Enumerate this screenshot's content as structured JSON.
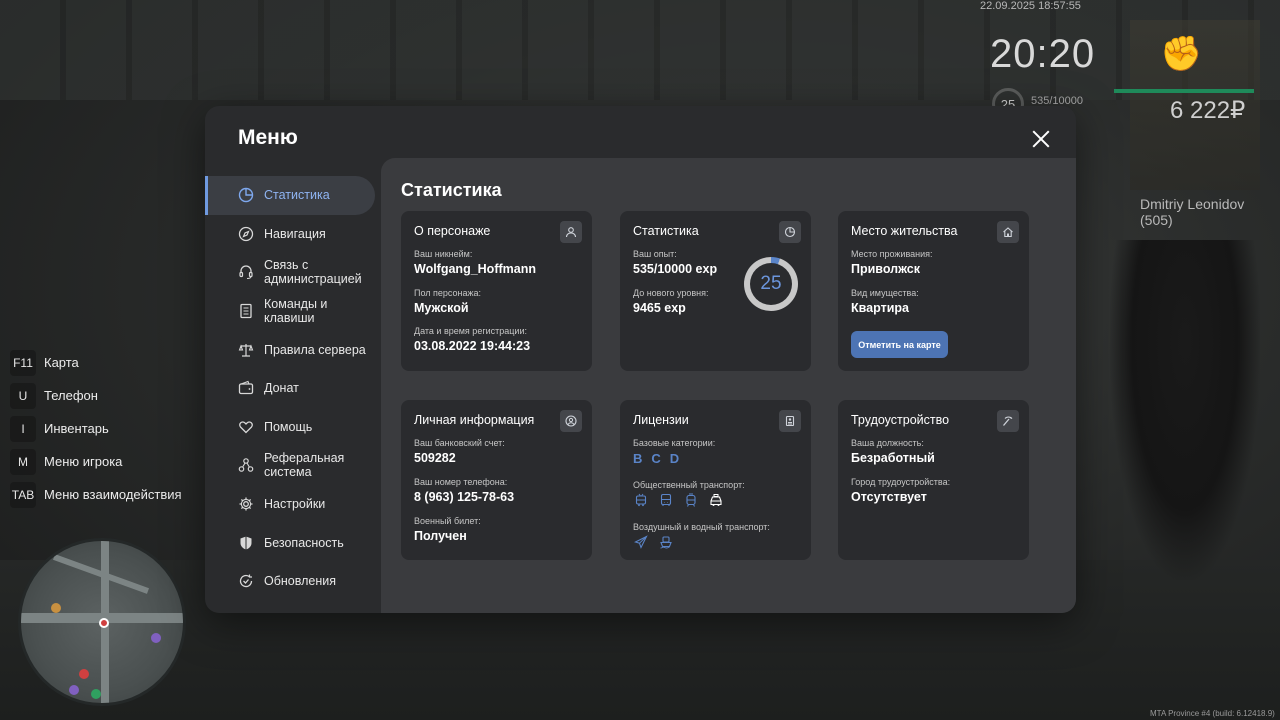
{
  "hud": {
    "datetime": "22.09.2025 18:57:55",
    "clock": "20:20",
    "level": "25",
    "exp": "535/10000",
    "money": "6 222₽",
    "player_tag": "Dmitriy Leonidov (505)"
  },
  "keys": [
    {
      "key": "F11",
      "label": "Карта"
    },
    {
      "key": "U",
      "label": "Телефон"
    },
    {
      "key": "I",
      "label": "Инвентарь"
    },
    {
      "key": "M",
      "label": "Меню игрока"
    },
    {
      "key": "TAB",
      "label": "Меню взаимодействия"
    }
  ],
  "version": "MTA Province #4 (build: 6.12418.9)",
  "menu": {
    "title": "Меню",
    "sidebar": [
      {
        "label": "Статистика",
        "icon": "stats-icon",
        "active": true
      },
      {
        "label": "Навигация",
        "icon": "compass-icon"
      },
      {
        "label": "Связь с администрацией",
        "icon": "headset-icon"
      },
      {
        "label": "Команды и клавиши",
        "icon": "document-icon"
      },
      {
        "label": "Правила сервера",
        "icon": "scales-icon"
      },
      {
        "label": "Донат",
        "icon": "wallet-icon"
      },
      {
        "label": "Помощь",
        "icon": "heart-hands-icon"
      },
      {
        "label": "Реферальная система",
        "icon": "people-network-icon"
      },
      {
        "label": "Настройки",
        "icon": "gear-icon"
      },
      {
        "label": "Безопасность",
        "icon": "shield-icon"
      },
      {
        "label": "Обновления",
        "icon": "refresh-check-icon"
      }
    ],
    "content_title": "Статистика",
    "cards": {
      "character": {
        "title": "О персонаже",
        "icon": "user-icon",
        "nickname_label": "Ваш никнейм:",
        "nickname": "Wolfgang_Hoffmann",
        "gender_label": "Пол персонажа:",
        "gender": "Мужской",
        "reg_label": "Дата и время регистрации:",
        "reg_date": "03.08.2022 19:44:23"
      },
      "stats": {
        "title": "Статистика",
        "icon": "pie-chart-icon",
        "exp_label": "Ваш опыт:",
        "exp": "535/10000 exp",
        "next_label": "До нового уровня:",
        "next": "9465 exp",
        "level": "25",
        "progress_fraction": 0.0535
      },
      "residence": {
        "title": "Место жительства",
        "icon": "house-icon",
        "place_label": "Место проживания:",
        "place": "Приволжск",
        "type_label": "Вид имущества:",
        "type": "Квартира",
        "button": "Отметить на карте"
      },
      "personal": {
        "title": "Личная информация",
        "icon": "user-circle-icon",
        "bank_label": "Ваш банковский счет:",
        "bank": "509282",
        "phone_label": "Ваш номер телефона:",
        "phone": "8 (963) 125-78-63",
        "military_label": "Военный билет:",
        "military": "Получен"
      },
      "licenses": {
        "title": "Лицензии",
        "icon": "id-card-icon",
        "basic_label": "Базовые категории:",
        "categories": [
          "B",
          "C",
          "D"
        ],
        "public_label": "Общественный транспорт:",
        "air_label": "Воздушный и водный транспорт:"
      },
      "employment": {
        "title": "Трудоустройство",
        "icon": "pickaxe-icon",
        "position_label": "Ваша должность:",
        "position": "Безработный",
        "city_label": "Город трудоустройства:",
        "city": "Отсутствует"
      }
    }
  }
}
